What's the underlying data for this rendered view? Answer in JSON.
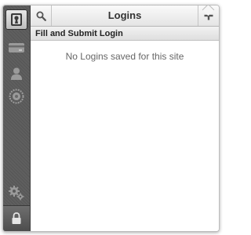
{
  "toolbar": {
    "title": "Logins",
    "search_icon": "search-icon",
    "add_icon": "plus-icon"
  },
  "section": {
    "header": "Fill and Submit Login",
    "empty_message": "No Logins saved for this site"
  },
  "sidebar": {
    "items": [
      {
        "name": "logins",
        "icon": "keyhole-card-icon",
        "active": true
      },
      {
        "name": "wallet",
        "icon": "credit-card-icon",
        "active": false
      },
      {
        "name": "identities",
        "icon": "person-icon",
        "active": false
      },
      {
        "name": "generator",
        "icon": "dial-icon",
        "active": false
      }
    ],
    "bottom": [
      {
        "name": "settings",
        "icon": "gears-icon"
      },
      {
        "name": "lock",
        "icon": "lock-icon"
      }
    ]
  },
  "colors": {
    "sidebar_bg": "#5a5a5a",
    "toolbar_bg": "#eeeeee",
    "text": "#333333",
    "muted_text": "#666666"
  }
}
